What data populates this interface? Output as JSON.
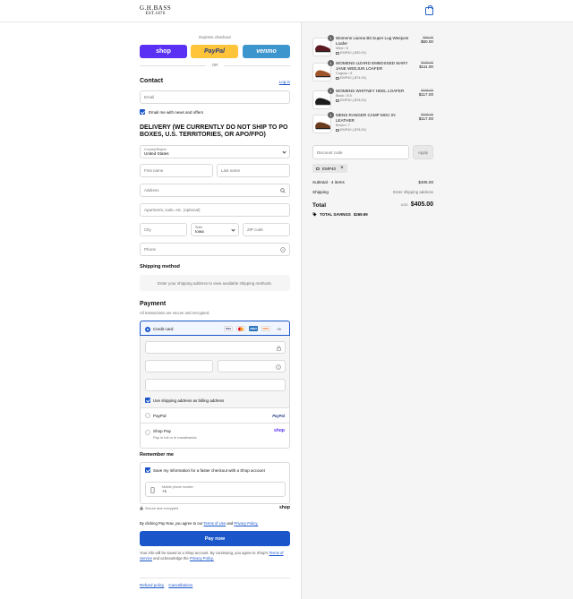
{
  "header": {
    "brand_line1": "G.H.BASS",
    "brand_line2": "EST.1876",
    "cart_icon": "shopping-bag-icon"
  },
  "express": {
    "label": "Express checkout",
    "shop": "shop",
    "paypal": "PayPal",
    "venmo": "venmo",
    "or": "OR"
  },
  "contact": {
    "title": "Contact",
    "login": "Log in",
    "email_placeholder": "Email",
    "newsletter": "Email me with news and offers"
  },
  "delivery": {
    "title": "DELIVERY (WE CURRENTLY DO NOT SHIP TO PO BOXES, U.S. TERRITORIES, OR APO/FPO)",
    "country_label": "Country/Region",
    "country_value": "United States",
    "first_name": "First name",
    "last_name": "Last name",
    "address": "Address",
    "apartment": "Apartment, suite, etc. (optional)",
    "city": "City",
    "state_label": "State",
    "state_value": "Iowa",
    "zip": "ZIP code",
    "phone": "Phone"
  },
  "shipping": {
    "title": "Shipping method",
    "notice": "Enter your shipping address to view available shipping methods."
  },
  "payment": {
    "title": "Payment",
    "subtitle": "All transactions are secure and encrypted.",
    "credit_card": "Credit card",
    "cards": [
      "VISA",
      "MC",
      "AMEX",
      "DISC"
    ],
    "more_cards": "+3",
    "billing": "Use shipping address as billing address",
    "paypal": "PayPal",
    "paypal_logo": "PayPal",
    "shoppay": "Shop Pay",
    "shoppay_sub": "Pay in full or in installments",
    "shoppay_logo": "shop"
  },
  "remember": {
    "title": "Remember me",
    "save_info": "Save my information for a faster checkout with a Shop account",
    "mobile_label": "Mobile phone number",
    "mobile_value": "+1",
    "secure": "Secure and encrypted",
    "shop_logo": "shop"
  },
  "agree": {
    "prefix": "By clicking Pay Now, you agree to our",
    "terms": "Terms of Use",
    "and": "and",
    "privacy": "Privacy Policy."
  },
  "paynow": "Pay now",
  "footer_note": {
    "text1": "Your info will be saved to a Shop account. By continuing, you agree to Shop's",
    "terms": "Terms of Service",
    "text2": "and acknowledge the",
    "privacy": "Privacy Policy."
  },
  "footer_links": {
    "refund": "Refund policy",
    "cancel": "Cancellations"
  },
  "cart": {
    "items": [
      {
        "qty": "1",
        "name": "Womens Lianna Bit Super Lug Weejuns Loafer",
        "variant": "Wine / 6",
        "discount": "EMP40 (-$30.00)",
        "old_price": "$99.00",
        "price": "$60.00",
        "color": "#5c1a22"
      },
      {
        "qty": "1",
        "name": "WOMENS LIZARD EMBOSSED MARY JANE WEEJUN LOAFER",
        "variant": "Cognac / 8",
        "discount": "EMP40 (-$74.00)",
        "old_price": "$185.00",
        "price": "$111.00",
        "color": "#a0562a"
      },
      {
        "qty": "1",
        "name": "WOMENS WHITNEY HEEL LOAFER",
        "variant": "Black / 8.5",
        "discount": "EMP40 (-$78.00)",
        "old_price": "$195.00",
        "price": "$117.00",
        "color": "#1c1c1c"
      },
      {
        "qty": "1",
        "name": "MENS RANGER CAMP MOC IN LEATHER",
        "variant": "Brown / 7",
        "discount": "EMP40 (-$78.00)",
        "old_price": "$195.00",
        "price": "$117.00",
        "color": "#6b3b1e"
      }
    ],
    "discount_placeholder": "Discount code",
    "apply": "Apply",
    "applied_code": "EMP40",
    "subtotal_label": "Subtotal · 4 items",
    "subtotal": "$405.00",
    "shipping_label": "Shipping",
    "shipping_value": "Enter shipping address",
    "total_label": "Total",
    "currency": "USD",
    "total": "$405.00",
    "savings_label": "TOTAL SAVINGS",
    "savings": "$269.99"
  }
}
